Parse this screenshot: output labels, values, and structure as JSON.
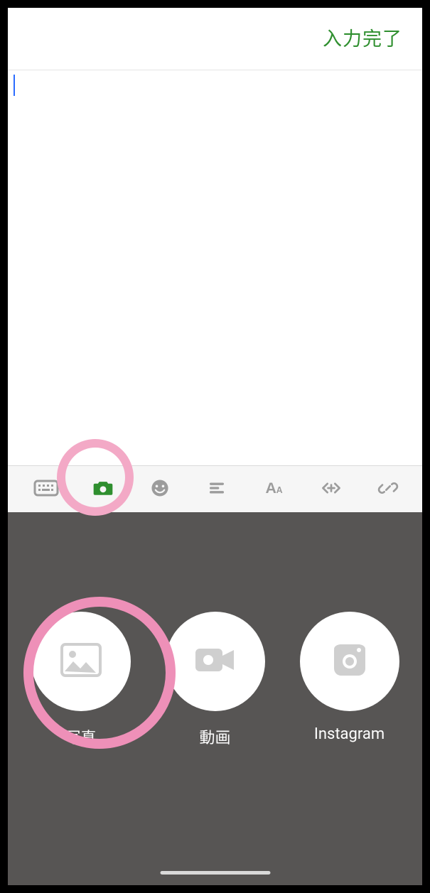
{
  "topbar": {
    "done_label": "入力完了"
  },
  "editor": {
    "content": ""
  },
  "toolbar": {
    "items": [
      {
        "name": "keyboard-icon"
      },
      {
        "name": "camera-icon"
      },
      {
        "name": "emoji-icon"
      },
      {
        "name": "align-icon"
      },
      {
        "name": "font-size-icon"
      },
      {
        "name": "code-icon"
      },
      {
        "name": "link-icon"
      }
    ]
  },
  "attach_panel": {
    "options": [
      {
        "id": "photo",
        "label": "写真"
      },
      {
        "id": "video",
        "label": "動画"
      },
      {
        "id": "instagram",
        "label": "Instagram"
      }
    ]
  },
  "annotations": {
    "ring_small_target": "camera-toolbar-button",
    "ring_large_target": "photo-option"
  },
  "colors": {
    "accent_green": "#2f8f2f",
    "panel_bg": "#575554",
    "annotation_pink": "#ee90b8"
  }
}
